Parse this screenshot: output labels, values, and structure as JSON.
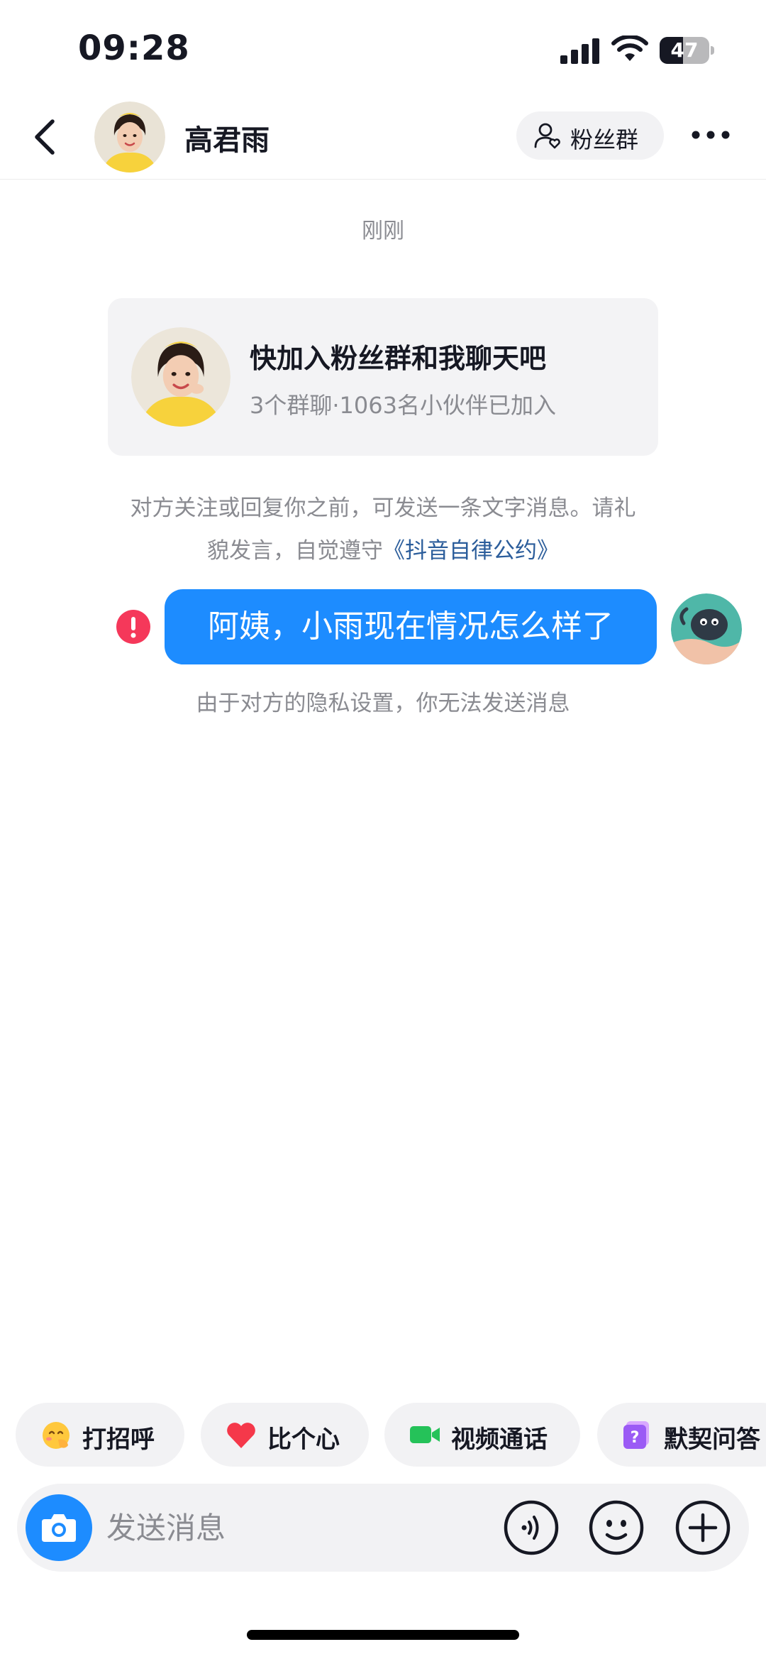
{
  "status_bar": {
    "time": "09:28",
    "battery_percent": "47",
    "battery_level": 0.47,
    "icons": [
      "signal-icon",
      "wifi-icon",
      "battery-icon"
    ]
  },
  "header": {
    "title": "高君雨",
    "fans_button_label": "粉丝群",
    "icons": [
      "back-icon",
      "avatar",
      "fans-group-icon",
      "more-icon"
    ]
  },
  "chat": {
    "timestamp": "刚刚",
    "invite_card": {
      "title": "快加入粉丝群和我聊天吧",
      "subtitle": "3个群聊·1063名小伙伴已加入"
    },
    "notice": {
      "text_line1": "对方关注或回复你之前，可发送一条文字消息。请礼",
      "text_line2": "貌发言，自觉遵守",
      "link_text": "《抖音自律公约》"
    },
    "message": {
      "text": "阿姨，小雨现在情况怎么样了",
      "status": "failed"
    },
    "privacy_note": "由于对方的隐私设置，你无法发送消息"
  },
  "quick_actions": [
    {
      "label": "打招呼",
      "icon": "wave-emoji-icon"
    },
    {
      "label": "比个心",
      "icon": "heart-icon"
    },
    {
      "label": "视频通话",
      "icon": "video-camera-icon"
    },
    {
      "label": "默契问答",
      "icon": "question-card-icon"
    }
  ],
  "input_bar": {
    "placeholder": "发送消息",
    "icons": [
      "camera-icon",
      "voice-icon",
      "emoji-icon",
      "plus-icon"
    ]
  },
  "colors": {
    "accent": "#1d8cff",
    "link": "#2b5d9b",
    "error": "#f5385a",
    "muted_text": "#8a8b91",
    "chip_bg": "#f2f2f4"
  }
}
